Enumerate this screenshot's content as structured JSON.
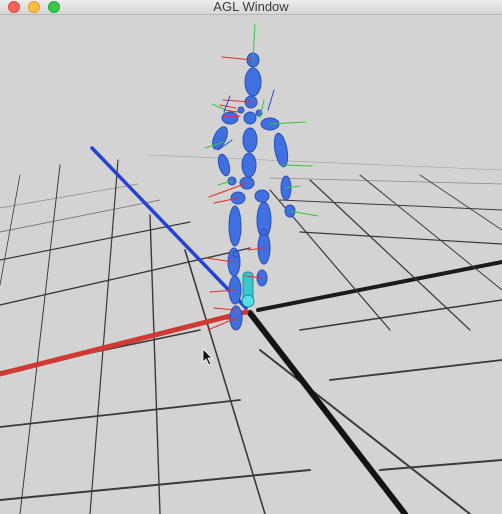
{
  "window": {
    "title": "AGL Window",
    "controls": [
      "close",
      "minimize",
      "zoom"
    ]
  },
  "scene": {
    "background": "#d3d3d3",
    "grid_color": "#2a2a2a",
    "axis_colors": {
      "x": "#d0302a",
      "y": "#32c832",
      "z": "#1f3fd6"
    },
    "character_color": "#3f6fe0",
    "highlight_color": "#39c6cf"
  }
}
